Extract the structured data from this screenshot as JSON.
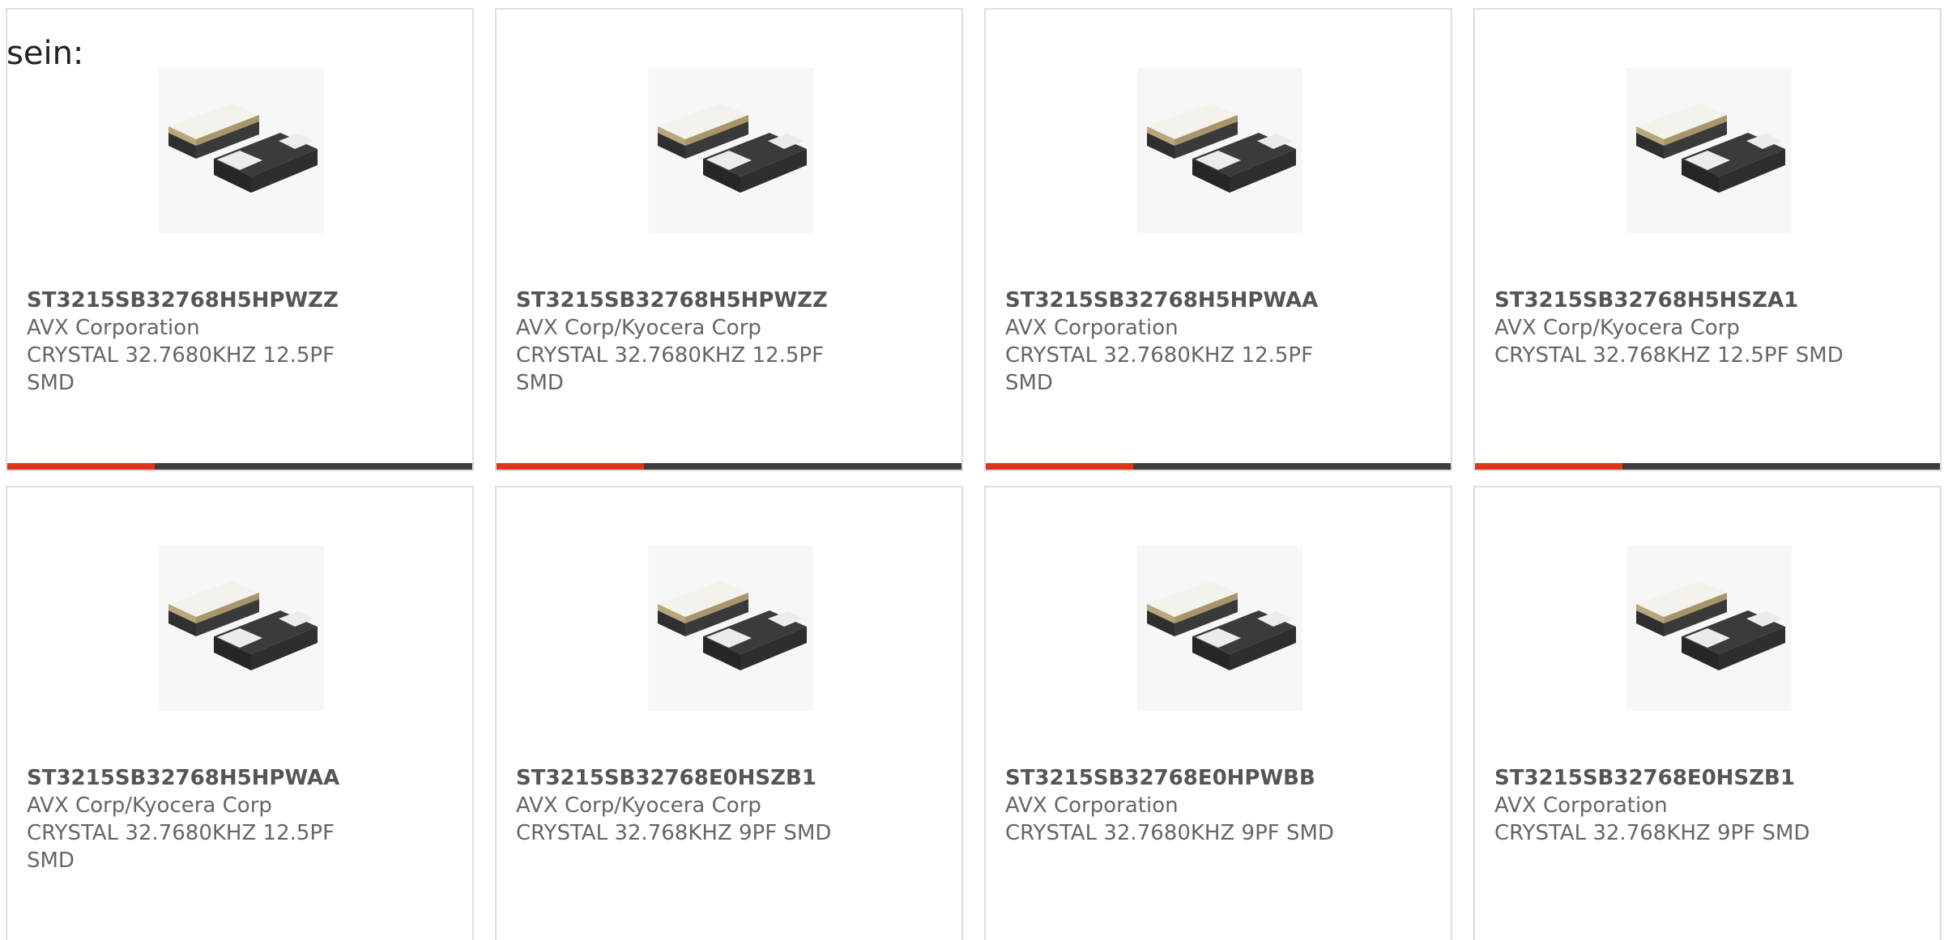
{
  "heading": "sein:",
  "colors": {
    "accent": "#e0341a",
    "bar": "#3d3d3d",
    "border": "#dedede"
  },
  "product_icon": "smd-crystal-image",
  "products": [
    {
      "part": "ST3215SB32768H5HPWZZ",
      "manufacturer": "AVX Corporation",
      "description": "CRYSTAL 32.7680KHZ 12.5PF SMD"
    },
    {
      "part": "ST3215SB32768H5HPWZZ",
      "manufacturer": "AVX Corp/Kyocera Corp",
      "description": "CRYSTAL 32.7680KHZ 12.5PF SMD"
    },
    {
      "part": "ST3215SB32768H5HPWAA",
      "manufacturer": "AVX Corporation",
      "description": "CRYSTAL 32.7680KHZ 12.5PF SMD"
    },
    {
      "part": "ST3215SB32768H5HSZA1",
      "manufacturer": "AVX Corp/Kyocera Corp",
      "description": "CRYSTAL 32.768KHZ 12.5PF SMD"
    },
    {
      "part": "ST3215SB32768H5HPWAA",
      "manufacturer": "AVX Corp/Kyocera Corp",
      "description": "CRYSTAL 32.7680KHZ 12.5PF SMD"
    },
    {
      "part": "ST3215SB32768E0HSZB1",
      "manufacturer": "AVX Corp/Kyocera Corp",
      "description": "CRYSTAL 32.768KHZ 9PF SMD"
    },
    {
      "part": "ST3215SB32768E0HPWBB",
      "manufacturer": "AVX Corporation",
      "description": "CRYSTAL 32.7680KHZ 9PF SMD"
    },
    {
      "part": "ST3215SB32768E0HSZB1",
      "manufacturer": "AVX Corporation",
      "description": "CRYSTAL 32.768KHZ 9PF SMD"
    }
  ]
}
